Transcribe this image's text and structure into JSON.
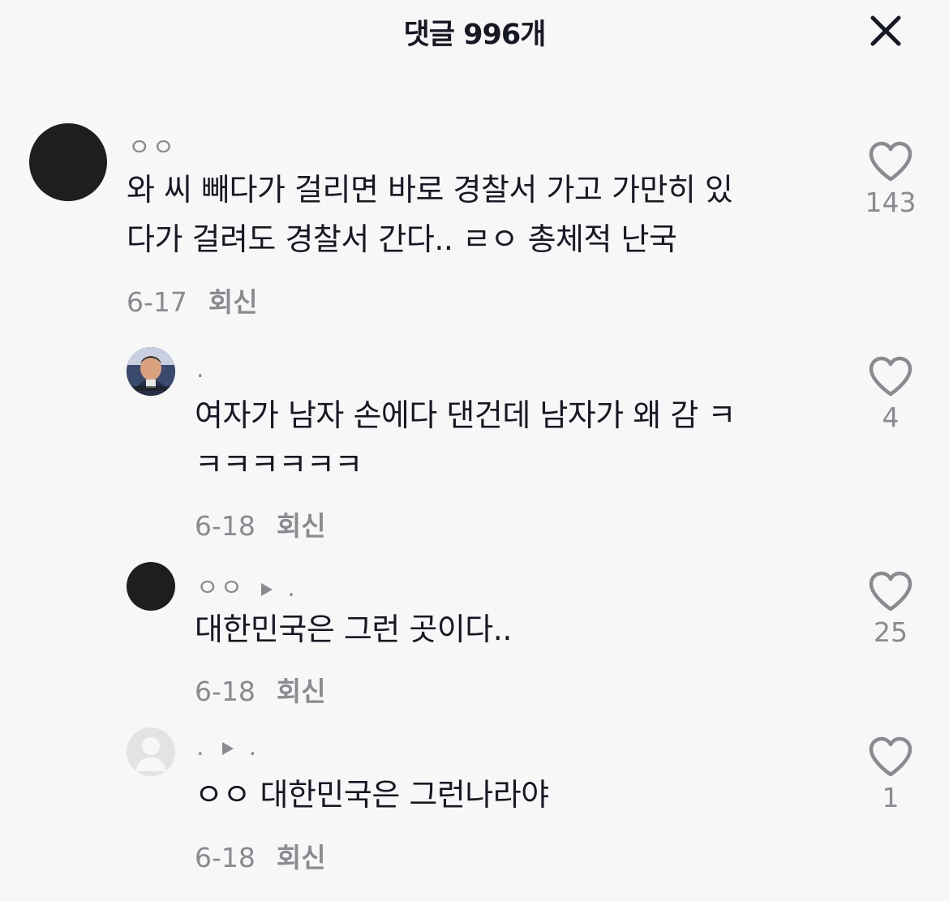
{
  "header": {
    "title": "댓글 996개",
    "close_icon": "close-icon"
  },
  "comments": [
    {
      "username": "ㅇㅇ",
      "text_lines": [
        "와 씨 빼다가 걸리면 바로 경찰서 가고 가만히 있",
        "다가 걸려도 경찰서 간다.. ㄹㅇ 총체적 난국"
      ],
      "date": "6-17",
      "reply_label": "회신",
      "likes": "143"
    },
    {
      "username": ".",
      "text_lines": [
        "여자가 남자 손에다 댄건데 남자가 왜 감 ㅋ",
        "ㅋㅋㅋㅋㅋㅋ"
      ],
      "date": "6-18",
      "reply_label": "회신",
      "likes": "4"
    },
    {
      "username": "ㅇㅇ",
      "reply_to": ".",
      "text_lines": [
        "대한민국은 그런 곳이다.."
      ],
      "date": "6-18",
      "reply_label": "회신",
      "likes": "25"
    },
    {
      "username": ".",
      "reply_to": ".",
      "text_lines": [
        "ㅇㅇ 대한민국은 그런나라야"
      ],
      "date": "6-18",
      "reply_label": "회신",
      "likes": "1"
    }
  ],
  "icons": {
    "like": "heart-outline-icon",
    "reply_arrow": "play-triangle-icon"
  }
}
